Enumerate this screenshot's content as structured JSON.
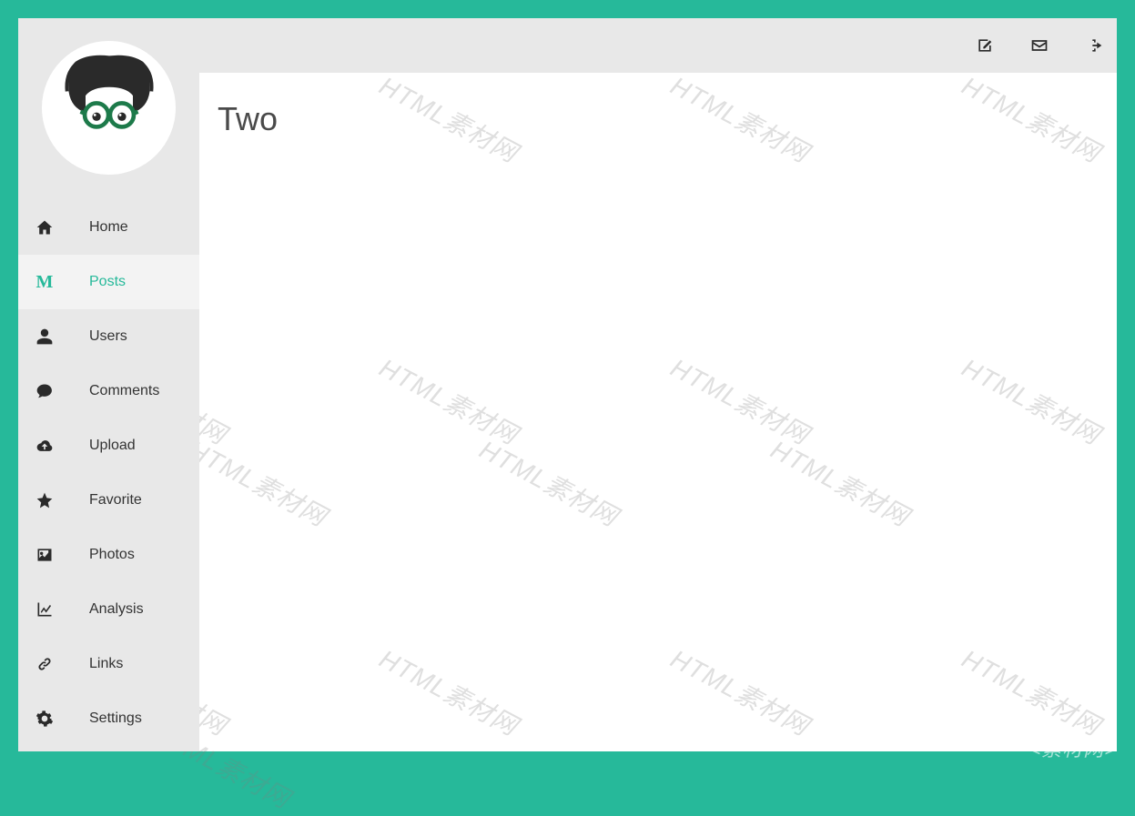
{
  "page": {
    "title": "Two"
  },
  "sidebar": {
    "items": [
      {
        "label": "Home",
        "icon": "home"
      },
      {
        "label": "Posts",
        "icon": "M",
        "active": true
      },
      {
        "label": "Users",
        "icon": "user"
      },
      {
        "label": "Comments",
        "icon": "comment"
      },
      {
        "label": "Upload",
        "icon": "cloud-upload"
      },
      {
        "label": "Favorite",
        "icon": "star"
      },
      {
        "label": "Photos",
        "icon": "picture"
      },
      {
        "label": "Analysis",
        "icon": "chart"
      },
      {
        "label": "Links",
        "icon": "link"
      },
      {
        "label": "Settings",
        "icon": "gear"
      }
    ]
  },
  "topbar": {
    "icons": [
      "edit",
      "envelope",
      "sign-out"
    ]
  },
  "watermark": {
    "text": "HTML素材网",
    "footer": "<素材网>"
  }
}
